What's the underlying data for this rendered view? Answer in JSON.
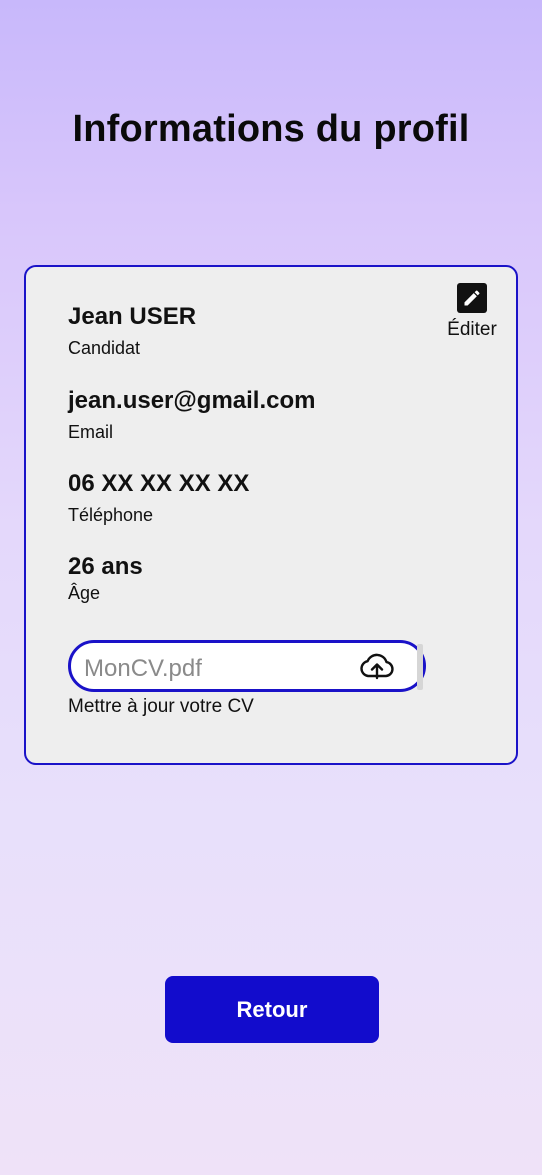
{
  "page": {
    "title": "Informations du profil"
  },
  "profile": {
    "edit_label": "Éditer",
    "name": "Jean USER",
    "name_label": "Candidat",
    "email": "jean.user@gmail.com",
    "email_label": "Email",
    "phone": "06 XX XX XX XX",
    "phone_label": "Téléphone",
    "age": "26 ans",
    "age_label": "Âge"
  },
  "cv_upload": {
    "placeholder": "MonCV.pdf",
    "caption": "Mettre à jour votre CV",
    "icon": "cloud-upload-icon"
  },
  "actions": {
    "back_label": "Retour"
  },
  "colors": {
    "accent": "#1a12c8",
    "button": "#120ccc",
    "card_bg": "#eeeeee"
  }
}
